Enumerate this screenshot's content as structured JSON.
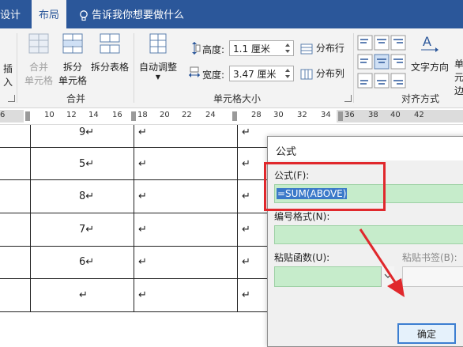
{
  "tabs": {
    "design": "设计",
    "layout": "布局",
    "tell_me": "告诉我你想要做什么"
  },
  "ribbon": {
    "insert_partial": "插入",
    "merge_cells": [
      "合并",
      "单元格"
    ],
    "split_cells": [
      "拆分",
      "单元格"
    ],
    "split_table": "拆分表格",
    "autofit": "自动调整",
    "height_label": "高度:",
    "height_value": "1.1 厘米",
    "width_label": "宽度:",
    "width_value": "3.47 厘米",
    "distribute_rows": "分布行",
    "distribute_cols": "分布列",
    "text_direction": "文字方向",
    "cell_margin_partial": [
      "单元",
      "边"
    ],
    "group_merge": "合并",
    "group_cell_size": "单元格大小",
    "group_align": "对齐方式"
  },
  "ruler": {
    "ticks": [
      "6",
      "10",
      "12",
      "14",
      "16",
      "18",
      "20",
      "22",
      "24",
      "28",
      "30",
      "32",
      "34",
      "36",
      "38",
      "40",
      "42"
    ]
  },
  "table": {
    "rows": [
      "9↵",
      "5↵",
      "8↵",
      "7↵",
      "6↵",
      "↵"
    ],
    "empty_mark": "↵"
  },
  "dialog": {
    "title": "公式",
    "formula_label": "公式(F):",
    "formula_value": "=SUM(ABOVE)",
    "number_format_label": "编号格式(N):",
    "paste_function_label": "粘贴函数(U):",
    "paste_bookmark_label": "粘贴书签(B):",
    "ok_label": "确定"
  },
  "colors": {
    "ribbon_blue": "#2b579a",
    "highlight_red": "#e0282c",
    "field_green": "#c6eccb",
    "selection_blue": "#3b79c9"
  }
}
